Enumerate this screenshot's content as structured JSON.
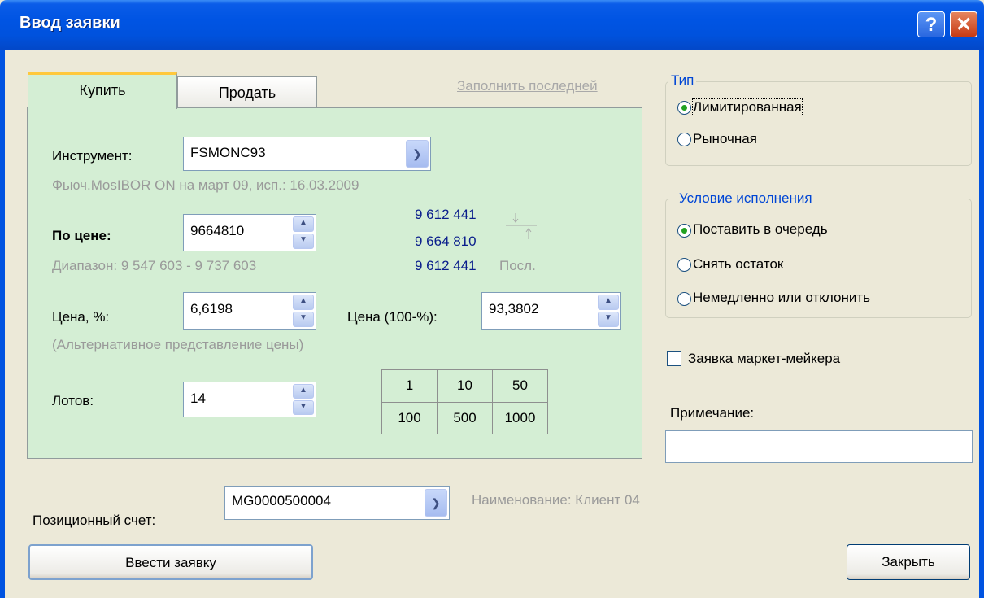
{
  "window": {
    "title": "Ввод заявки",
    "help_glyph": "?",
    "close_glyph": "✕"
  },
  "tabs": {
    "buy": "Купить",
    "sell": "Продать",
    "fill_last": "Заполнить последней"
  },
  "instrument": {
    "label": "Инструмент:",
    "value": "FSMONC93",
    "description": "Фьюч.MosIBOR ON на март 09, исп.: 16.03.2009"
  },
  "price": {
    "label": "По цене:",
    "value": "9664810",
    "range": "Диапазон: 9 547 603 - 9 737 603",
    "quote_top": "9 612 441",
    "quote_mid": "9 664 810",
    "quote_last": "9 612 441",
    "quote_last_label": "Посл."
  },
  "percent": {
    "label": "Цена, %:",
    "value": "6,6198",
    "label2": "Цена (100-%):",
    "value2": "93,3802",
    "note": "(Альтернативное представление цены)"
  },
  "lots": {
    "label": "Лотов:",
    "value": "14",
    "presets": [
      [
        "1",
        "10",
        "50"
      ],
      [
        "100",
        "500",
        "1000"
      ]
    ]
  },
  "account": {
    "label": "Позиционный счет:",
    "value": "MG0000500004",
    "name": "Наименование: Клиент 04"
  },
  "type_group": {
    "title": "Тип",
    "options": [
      {
        "label": "Лимитированная",
        "selected": true
      },
      {
        "label": "Рыночная",
        "selected": false
      }
    ]
  },
  "exec_group": {
    "title": "Условие исполнения",
    "options": [
      {
        "label": "Поставить в очередь",
        "selected": true
      },
      {
        "label": "Снять остаток",
        "selected": false
      },
      {
        "label": "Немедленно или отклонить",
        "selected": false
      }
    ]
  },
  "market_maker": {
    "label": "Заявка маркет-мейкера",
    "checked": false
  },
  "note": {
    "label": "Примечание:",
    "value": ""
  },
  "buttons": {
    "submit": "Ввести заявку",
    "close": "Закрыть"
  }
}
